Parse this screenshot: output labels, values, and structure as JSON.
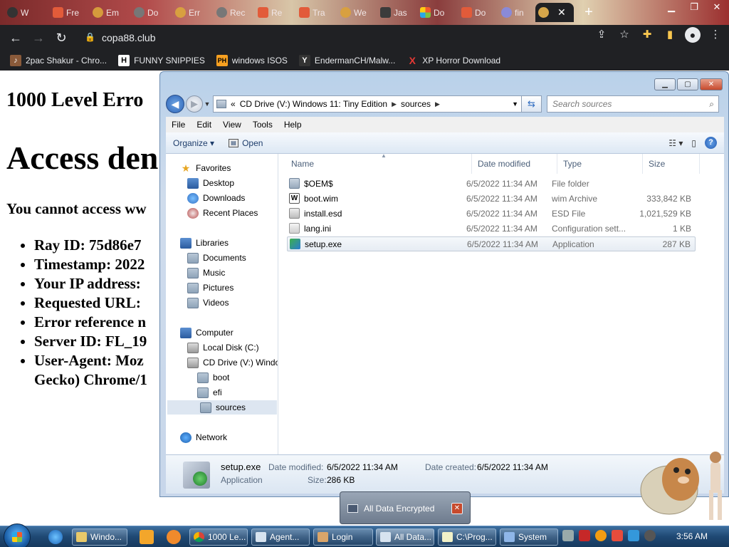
{
  "browser": {
    "tabs": [
      {
        "label": "W"
      },
      {
        "label": "Fre"
      },
      {
        "label": "Em"
      },
      {
        "label": "Do"
      },
      {
        "label": "Err"
      },
      {
        "label": "Rec"
      },
      {
        "label": "Re"
      },
      {
        "label": "Tra"
      },
      {
        "label": "We"
      },
      {
        "label": "Jas"
      },
      {
        "label": "Do"
      },
      {
        "label": "Do"
      },
      {
        "label": "fin"
      }
    ],
    "active_tab_close": "✕",
    "new_tab": "+",
    "url": "copa88.club",
    "bookmarks": [
      {
        "label": "2pac Shakur - Chro...",
        "icon": "🟫"
      },
      {
        "label": "FUNNY SNIPPIES",
        "icon": "H"
      },
      {
        "label": "windows ISOS",
        "icon": "PH"
      },
      {
        "label": "EndermanCH/Malw...",
        "icon": "Y"
      },
      {
        "label": "XP Horror Download",
        "icon": "X"
      }
    ]
  },
  "webpage": {
    "heading_small": "1000 Level Erro",
    "heading_big": "Access den",
    "lead": "You cannot access ww",
    "list": [
      "Ray ID: 75d86e7",
      "Timestamp: 2022",
      "Your IP address:",
      "Requested URL:",
      "Error reference n",
      "Server ID: FL_19",
      "User-Agent: Moz",
      "Gecko) Chrome/1"
    ]
  },
  "explorer": {
    "address": {
      "prefix": "«",
      "crumbs": [
        "CD Drive (V:) Windows 11: Tiny Edition",
        "sources"
      ]
    },
    "search_placeholder": "Search sources",
    "menu": [
      "File",
      "Edit",
      "View",
      "Tools",
      "Help"
    ],
    "commands": {
      "organize": "Organize ▾",
      "open": "Open"
    },
    "nav": {
      "favorites": "Favorites",
      "desktop": "Desktop",
      "downloads": "Downloads",
      "recent": "Recent Places",
      "libraries": "Libraries",
      "documents": "Documents",
      "music": "Music",
      "pictures": "Pictures",
      "videos": "Videos",
      "computer": "Computer",
      "local_disk": "Local Disk (C:)",
      "cd_drive": "CD Drive (V:) Windo",
      "boot": "boot",
      "efi": "efi",
      "sources": "sources",
      "network": "Network"
    },
    "columns": {
      "name": "Name",
      "date": "Date modified",
      "type": "Type",
      "size": "Size"
    },
    "files": [
      {
        "name": "$OEM$",
        "date": "6/5/2022 11:34 AM",
        "type": "File folder",
        "size": ""
      },
      {
        "name": "boot.wim",
        "date": "6/5/2022 11:34 AM",
        "type": "wim Archive",
        "size": "333,842 KB"
      },
      {
        "name": "install.esd",
        "date": "6/5/2022 11:34 AM",
        "type": "ESD File",
        "size": "1,021,529 KB"
      },
      {
        "name": "lang.ini",
        "date": "6/5/2022 11:34 AM",
        "type": "Configuration sett...",
        "size": "1 KB"
      },
      {
        "name": "setup.exe",
        "date": "6/5/2022 11:34 AM",
        "type": "Application",
        "size": "287 KB"
      }
    ],
    "details": {
      "name": "setup.exe",
      "kind": "Application",
      "modified_label": "Date modified:",
      "modified": "6/5/2022 11:34 AM",
      "size_label": "Size:",
      "size": "286 KB",
      "created_label": "Date created:",
      "created": "6/5/2022 11:34 AM"
    }
  },
  "popup": {
    "label": "All Data Encrypted",
    "close": "✕"
  },
  "taskbar": {
    "buttons": [
      "Windo...",
      "1000 Le...",
      "Agent...",
      "Login",
      "All Data...",
      "C:\\Prog...",
      "System"
    ],
    "clock": "3:56 AM"
  }
}
